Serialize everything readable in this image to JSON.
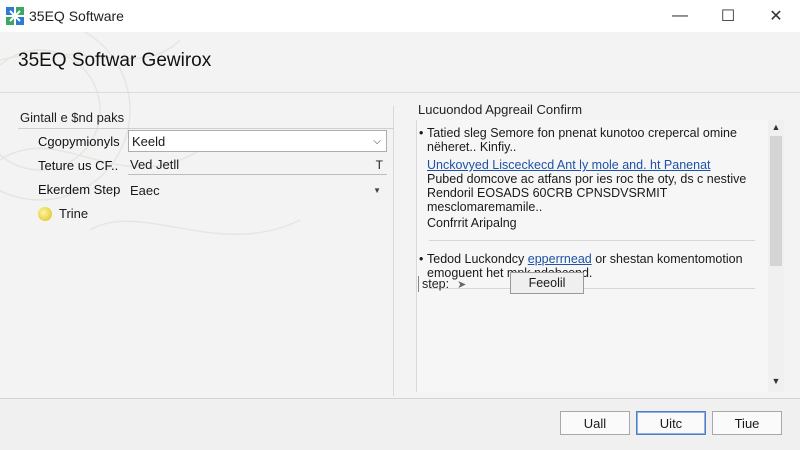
{
  "window": {
    "title": "35EQ Software",
    "minimize_glyph": "—",
    "maximize_glyph": "☐",
    "close_glyph": "✕",
    "logo_icon": "app-logo-icon"
  },
  "header": {
    "title": "35EQ Softwar Gewirox"
  },
  "left_panel": {
    "section_title": "Gintall e $nd paks",
    "fields": [
      {
        "label": "Cgopymionyls",
        "value": "Keeld",
        "type": "dropdown"
      },
      {
        "label": "Teture us CF..",
        "value": "Ved  Jetll",
        "type": "text"
      },
      {
        "label": "Ekerdem Step",
        "value": "Eaec",
        "type": "select"
      }
    ],
    "toggle": {
      "label": "Trine",
      "state": "on",
      "color": "#e4cf3c"
    }
  },
  "right_panel": {
    "section_title": "Lucuondod Apgreail Confirm",
    "paragraphs": {
      "p1_line1": "Tatied sleg Semore fon pnenat kunotoo crepercal omine",
      "p1_line2": "nëheret.. Kinfiy..",
      "p2_link": "Unckovyed Lisceckecd Ant ly mole and. ht Panenat",
      "p2_line2": "Pubed domcove ac atfans por ies roc the oty, ds c nestive",
      "p2_line3": "Rendoril EOSADS 60CRB CPNSDVSRMIT",
      "p2_line4": "mesclomaremamile..",
      "p3_line1": "Confrrit Aripalng",
      "p4_prefix": "Tedod Luckondcy",
      "p4_link": "epperrnead",
      "p4_suffix": "or shestan komentomotion",
      "p4_line2": "emoguent het mpk ndabcend."
    },
    "step_label": "step:",
    "step_arrow_icon": "arrow-right-icon",
    "button_label": "Feeolil"
  },
  "footer": {
    "buttons": [
      {
        "label": "Uall"
      },
      {
        "label": "Uitc",
        "primary": true
      },
      {
        "label": "Tiue"
      }
    ]
  },
  "colors": {
    "link": "#1d52a8",
    "accent": "#4e7fc4",
    "background": "#f3f3f3"
  }
}
